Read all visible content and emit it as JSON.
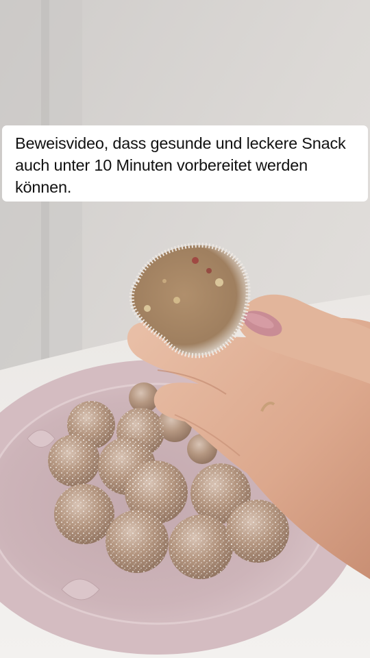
{
  "caption": {
    "text": "Beweisvideo, dass gesunde und leckere Snack auch unter 10 Minuten vorbereitet werden können."
  },
  "colors": {
    "wall": "#d9d6d3",
    "plate": "#cdb5bb",
    "ball": "#b79a84",
    "skin": "#e1b197",
    "nail": "#c98c95",
    "caption_bg": "#ffffff",
    "caption_text": "#111111"
  }
}
